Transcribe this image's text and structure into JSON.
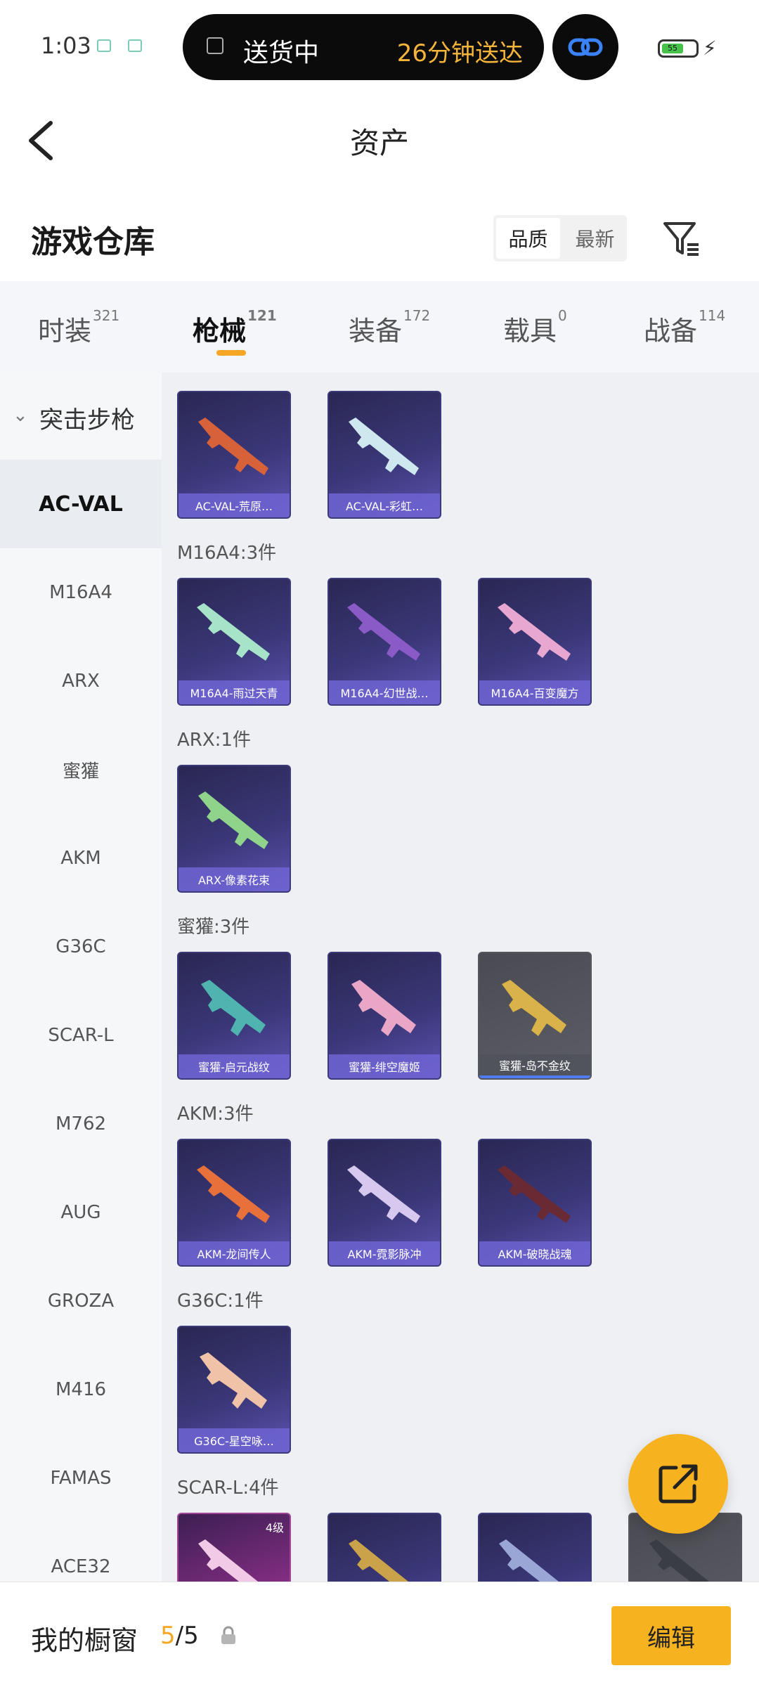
{
  "status_bar": {
    "time": "1:03",
    "island_text": "送货中",
    "island_eta": "26分钟送达",
    "battery_level": "55"
  },
  "header": {
    "title": "资产"
  },
  "section": {
    "title": "游戏仓库",
    "sort_options": [
      "品质",
      "最新"
    ],
    "sort_active": "品质"
  },
  "tabs": [
    {
      "label": "时装",
      "count": "321"
    },
    {
      "label": "枪械",
      "count": "121",
      "active": true
    },
    {
      "label": "装备",
      "count": "172"
    },
    {
      "label": "载具",
      "count": "0"
    },
    {
      "label": "战备",
      "count": "114"
    }
  ],
  "sidebar": {
    "category": "突击步枪",
    "items": [
      "AC-VAL",
      "M16A4",
      "ARX",
      "蜜獾",
      "AKM",
      "G36C",
      "SCAR-L",
      "M762",
      "AUG",
      "GROZA",
      "M416",
      "FAMAS",
      "ACE32"
    ],
    "active_index": 0
  },
  "groups": [
    {
      "label": "",
      "items": [
        "AC-VAL-荒原…",
        "AC-VAL-彩虹…"
      ]
    },
    {
      "label": "M16A4:3件",
      "items": [
        "M16A4-雨过天青",
        "M16A4-幻世战…",
        "M16A4-百变魔方"
      ]
    },
    {
      "label": "ARX:1件",
      "items": [
        "ARX-像素花束"
      ]
    },
    {
      "label": "蜜獾:3件",
      "items": [
        "蜜獾-启元战纹",
        "蜜獾-绯空魔姬",
        "蜜獾-岛不金纹"
      ]
    },
    {
      "label": "AKM:3件",
      "items": [
        "AKM-龙间传人",
        "AKM-霓影脉冲",
        "AKM-破晓战魂"
      ]
    },
    {
      "label": "G36C:1件",
      "items": [
        "G36C-星空咏…"
      ]
    },
    {
      "label": "SCAR-L:4件",
      "items": [
        "",
        "",
        "",
        ""
      ],
      "badge": "4级"
    }
  ],
  "bottom_bar": {
    "window_label": "我的橱窗",
    "count_current": "5",
    "count_total": "/5",
    "edit_label": "编辑"
  },
  "colors": {
    "accent": "#f7b21f",
    "card_purple": "#3a3778",
    "content_bg": "#eef0f3"
  }
}
